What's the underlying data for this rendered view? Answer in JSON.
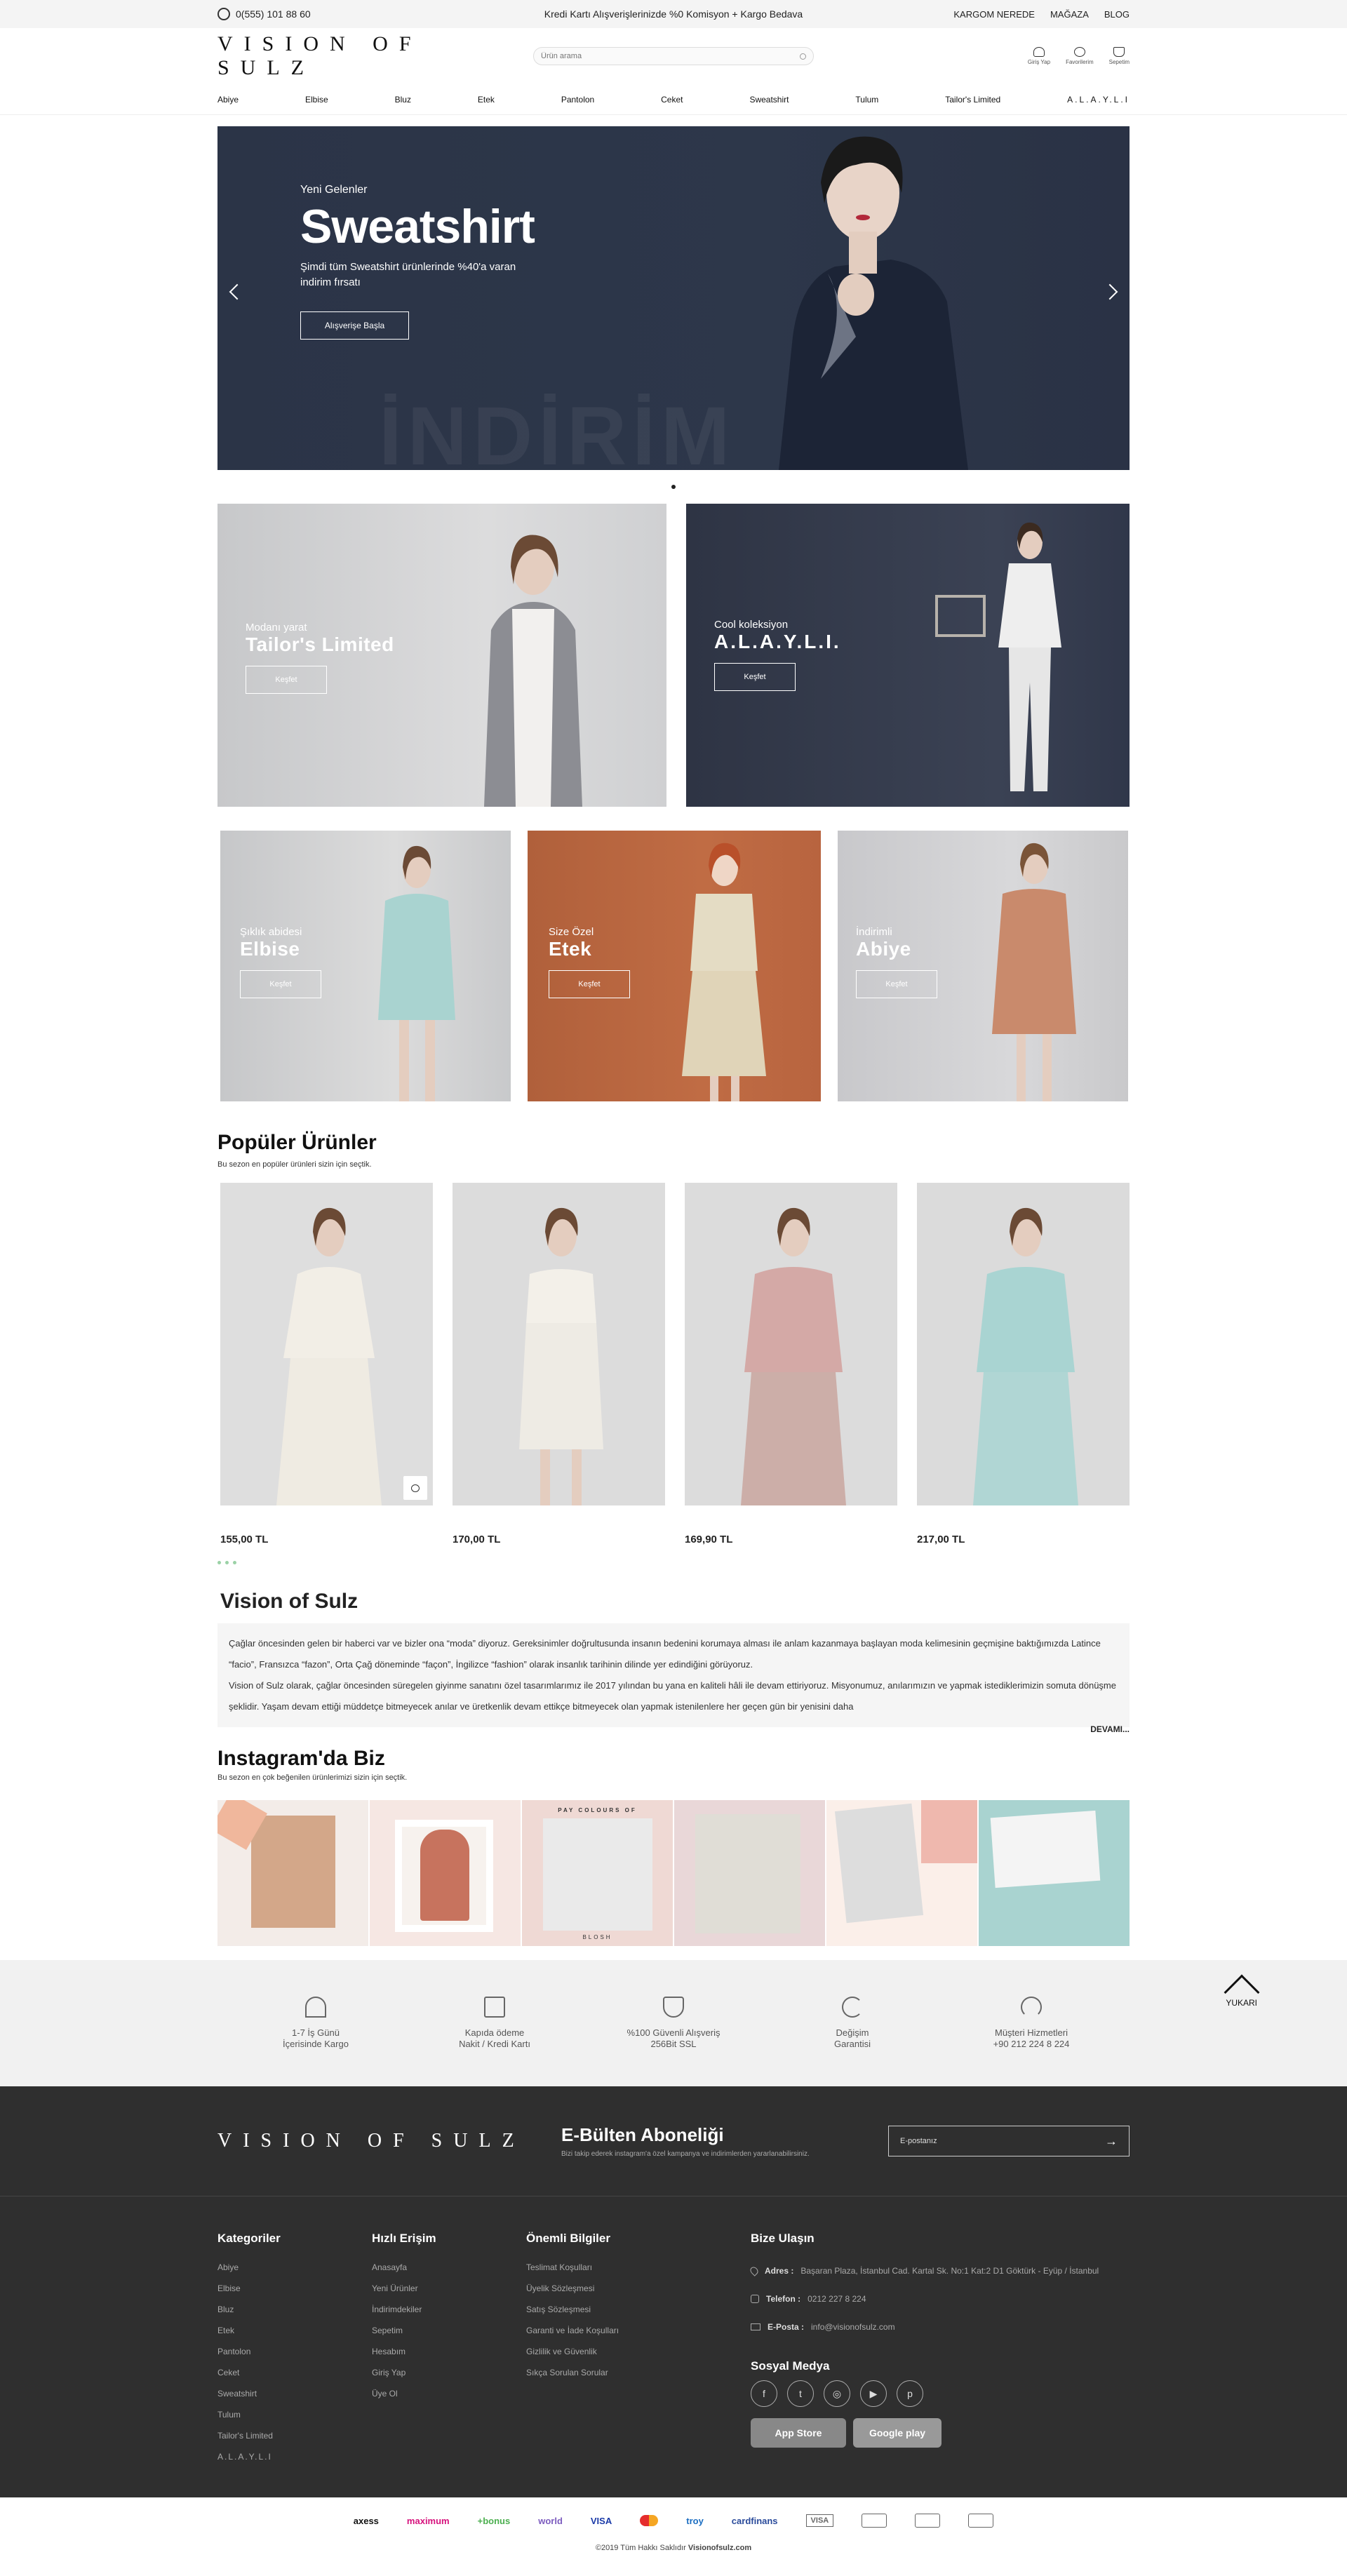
{
  "topbar": {
    "phone": "0(555) 101 88 60",
    "promo": "Kredi Kartı Alışverişlerinizde %0 Komisyon + Kargo Bedava",
    "links": [
      "KARGOM NEREDE",
      "MAĞAZA",
      "BLOG"
    ]
  },
  "header": {
    "logo": "VISION OF SULZ",
    "search_placeholder": "Ürün arama",
    "icons": [
      {
        "label": "Giriş Yap",
        "icon": "user-icon"
      },
      {
        "label": "Favorilerim",
        "icon": "heart-icon"
      },
      {
        "label": "Sepetim",
        "icon": "cart-icon"
      }
    ]
  },
  "nav": [
    "Abiye",
    "Elbise",
    "Bluz",
    "Etek",
    "Pantolon",
    "Ceket",
    "Sweatshirt",
    "Tulum",
    "Tailor's Limited",
    "A.L.A.Y.L.I"
  ],
  "hero": {
    "kicker": "Yeni Gelenler",
    "title": "Sweatshirt",
    "desc": "Şimdi tüm Sweatshirt ürünlerinde %40'a varan indirim fırsatı",
    "button": "Alışverişe Başla",
    "bg_word": "İNDİRİM"
  },
  "promo_large": [
    {
      "sub": "Modanı yarat",
      "title": "Tailor's Limited",
      "button": "Keşfet"
    },
    {
      "sub": "Cool koleksiyon",
      "title": "A.L.A.Y.L.I.",
      "button": "Keşfet"
    }
  ],
  "promo_small": [
    {
      "sub": "Şıklık abidesi",
      "title": "Elbise",
      "button": "Keşfet"
    },
    {
      "sub": "Size Özel",
      "title": "Etek",
      "button": "Keşfet"
    },
    {
      "sub": "İndirimli",
      "title": "Abiye",
      "button": "Keşfet"
    }
  ],
  "popular": {
    "title": "Popüler Ürünler",
    "subtitle": "Bu sezon en popüler ürünleri sizin için seçtik.",
    "products": [
      {
        "price": "155,00 TL"
      },
      {
        "price": "170,00 TL"
      },
      {
        "price": "169,90 TL"
      },
      {
        "price": "217,00 TL"
      }
    ]
  },
  "about": {
    "title": "Vision of Sulz",
    "p1": "Çağlar öncesinden gelen bir haberci var ve bizler ona “moda” diyoruz. Gereksinimler doğrultusunda insanın bedenini korumaya alması ile anlam kazanmaya başlayan moda kelimesinin geçmişine baktığımızda Latince “facio”, Fransızca “fazon”, Orta Çağ döneminde “façon”, İngilizce “fashion” olarak insanlık tarihinin dilinde yer edindiğini görüyoruz.",
    "p2": "Vision of Sulz olarak, çağlar öncesinden süregelen giyinme sanatını özel tasarımlarımız ile 2017 yılından bu yana en kaliteli hâli ile devam ettiriyoruz. Misyonumuz, anılarımızın ve yapmak istediklerimizin somuta dönüşme şeklidir. Yaşam devam ettiği müddetçe bitmeyecek anılar ve üretkenlik devam ettikçe bitmeyecek olan yapmak istenilenlere her geçen gün bir yenisini daha",
    "more": "DEVAMI..."
  },
  "instagram": {
    "title": "Instagram'da Biz",
    "subtitle": "Bu sezon en çok beğenilen ürünlerimizi sizin için seçtik.",
    "tile2": "PAY COLOURS OF",
    "tile3": "BLOSH"
  },
  "features": [
    {
      "l1": "1-7 İş Günü",
      "l2": "İçerisinde Kargo",
      "icon": "parachute-icon"
    },
    {
      "l1": "Kapıda ödeme",
      "l2": "Nakit / Kredi Kartı",
      "icon": "home-icon"
    },
    {
      "l1": "%100 Güvenli Alışveriş",
      "l2": "256Bit SSL",
      "icon": "shield-icon"
    },
    {
      "l1": "Değişim",
      "l2": "Garantisi",
      "icon": "refresh-icon"
    },
    {
      "l1": "Müşteri Hizmetleri",
      "l2": "+90 212 224 8 224",
      "icon": "headset-icon"
    }
  ],
  "up": "YUKARI",
  "newsletter": {
    "logo": "VISION OF SULZ",
    "title": "E-Bülten Aboneliği",
    "hint": "Bizi takip ederek instagram'a özel kampanya ve indirimlerden yararlanabilirsiniz.",
    "placeholder": "E-postanız"
  },
  "footer": {
    "categories": {
      "title": "Kategoriler",
      "items": [
        "Abiye",
        "Elbise",
        "Bluz",
        "Etek",
        "Pantolon",
        "Ceket",
        "Sweatshirt",
        "Tulum",
        "Tailor's Limited",
        "A.L.A.Y.L.I"
      ]
    },
    "quick": {
      "title": "Hızlı Erişim",
      "items": [
        "Anasayfa",
        "Yeni Ürünler",
        "İndirimdekiler",
        "Sepetim",
        "Hesabım",
        "Giriş Yap",
        "Üye Ol"
      ]
    },
    "info": {
      "title": "Önemli Bilgiler",
      "items": [
        "Teslimat Koşulları",
        "Üyelik Sözleşmesi",
        "Satış Sözleşmesi",
        "Garanti ve İade Koşulları",
        "Gizlilik ve Güvenlik",
        "Sıkça Sorulan Sorular"
      ]
    },
    "contact": {
      "title": "Bize Ulaşın",
      "address_label": "Adres :",
      "address": "Başaran Plaza, İstanbul Cad. Kartal Sk. No:1 Kat:2 D1 Göktürk - Eyüp / İstanbul",
      "phone_label": "Telefon :",
      "phone": "0212 227 8 224",
      "email_label": "E-Posta :",
      "email": "info@visionofsulz.com"
    },
    "social_title": "Sosyal Medya",
    "stores": [
      "App Store",
      "Google play"
    ]
  },
  "payments": [
    "axess",
    "maximum",
    "+bonus",
    "world",
    "VISA",
    "mastercard",
    "troy",
    "cardfinans",
    "VISA",
    "",
    "",
    "",
    ""
  ],
  "copyright": "©2019 Tüm Hakkı Saklıdır",
  "copyright_site": "Visionofsulz.com"
}
